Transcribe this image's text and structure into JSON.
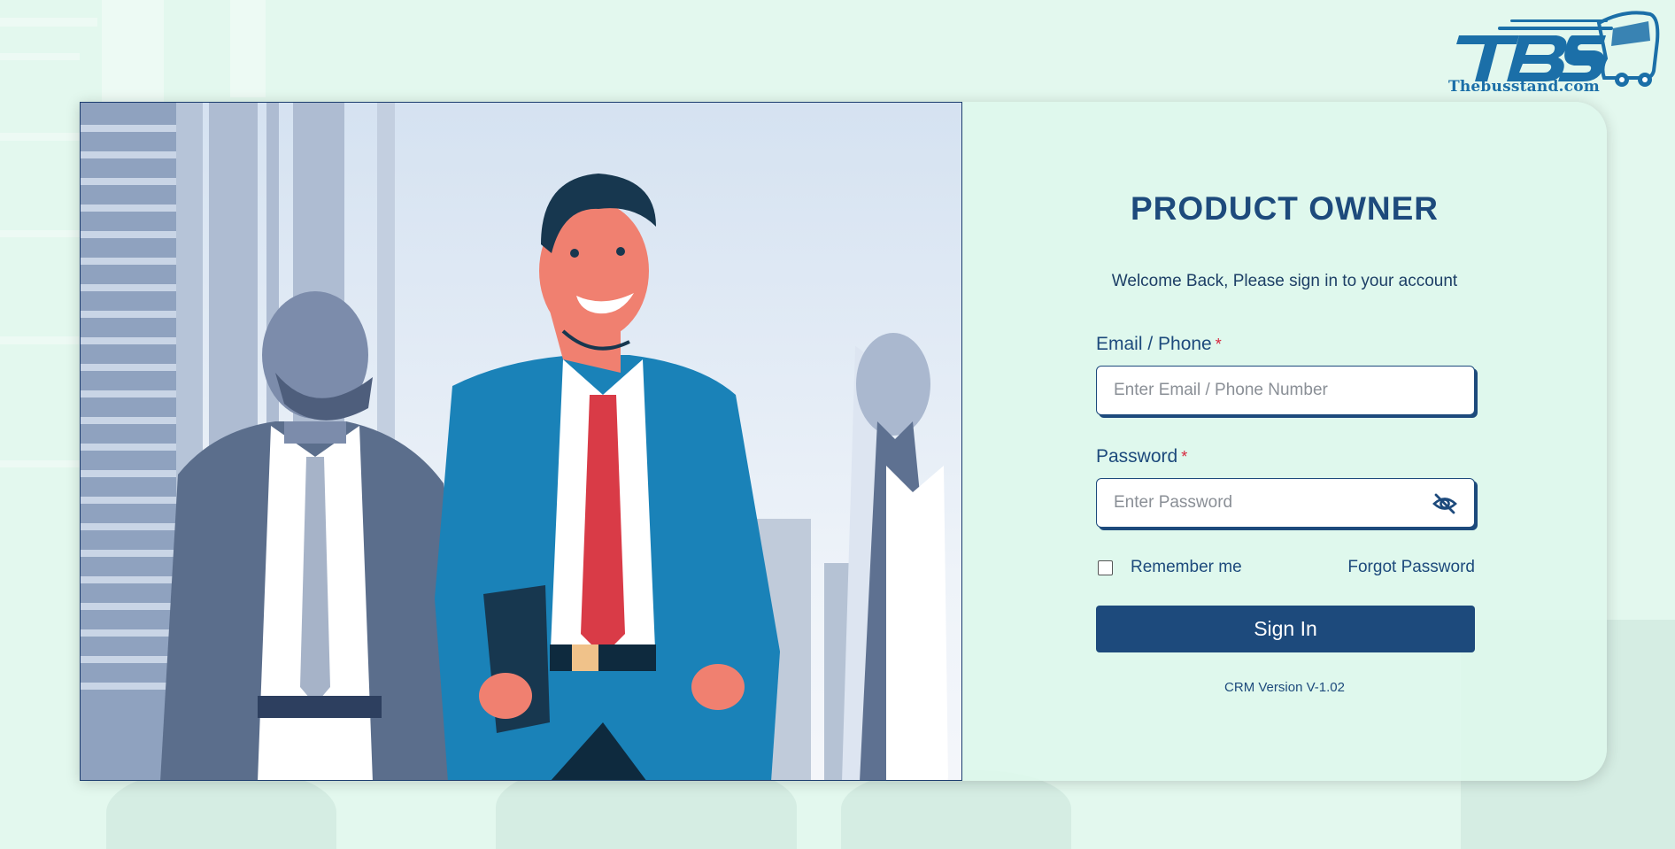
{
  "brand": {
    "logo_letters": "TBS",
    "logo_text": "Thebusstand.com"
  },
  "login": {
    "title": "PRODUCT OWNER",
    "subtitle": "Welcome Back, Please sign in to your account",
    "email_label": "Email / Phone",
    "email_placeholder": "Enter Email / Phone Number",
    "email_value": "",
    "password_label": "Password",
    "password_placeholder": "Enter Password",
    "password_value": "",
    "required_mark": "*",
    "remember_label": "Remember me",
    "remember_checked": false,
    "forgot_label": "Forgot Password",
    "signin_label": "Sign In",
    "version": "CRM Version V-1.02"
  },
  "icons": {
    "password_toggle": "eye-slash-icon",
    "logo": "bus-icon"
  },
  "colors": {
    "primary": "#1d4a7c",
    "required": "#d7263d",
    "background": "#e3f8ee",
    "logo_blue": "#1b6fa8"
  }
}
